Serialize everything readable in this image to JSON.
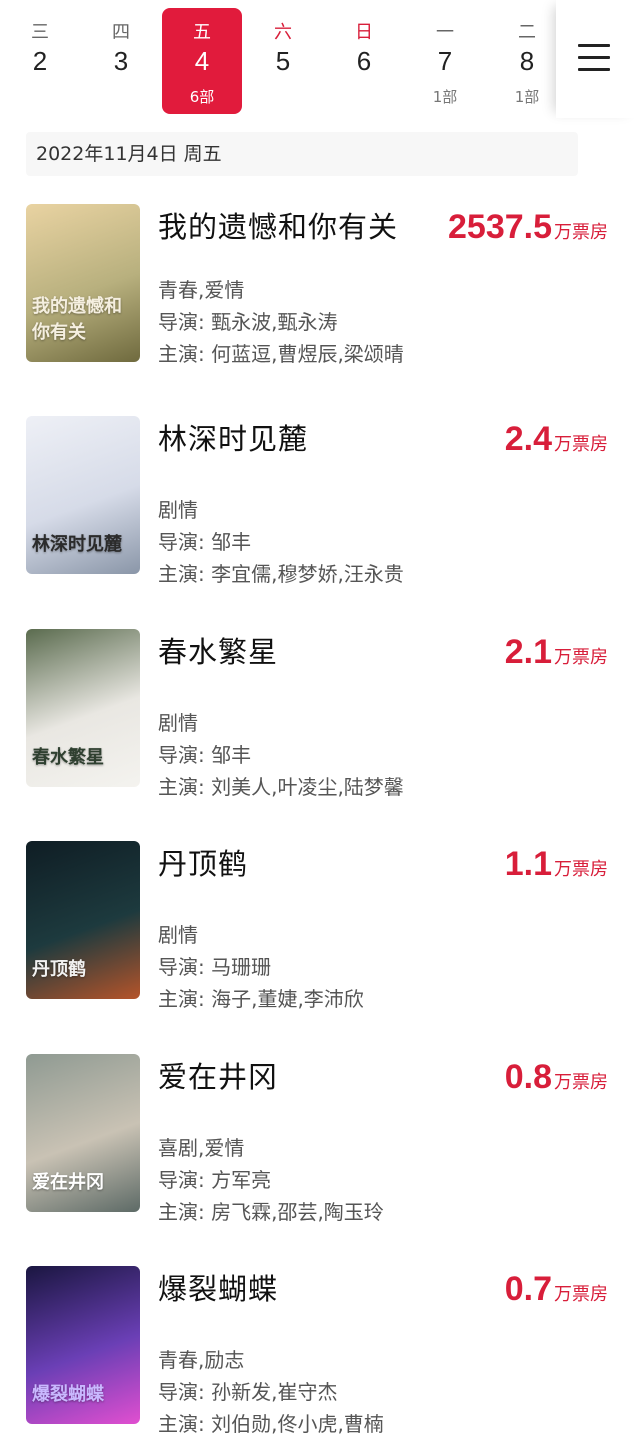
{
  "week": [
    {
      "weekday": "三",
      "date": "2",
      "count": "",
      "weekend": false,
      "active": false
    },
    {
      "weekday": "四",
      "date": "3",
      "count": "",
      "weekend": false,
      "active": false
    },
    {
      "weekday": "五",
      "date": "4",
      "count": "6部",
      "weekend": false,
      "active": true
    },
    {
      "weekday": "六",
      "date": "5",
      "count": "",
      "weekend": true,
      "active": false
    },
    {
      "weekday": "日",
      "date": "6",
      "count": "",
      "weekend": true,
      "active": false
    },
    {
      "weekday": "一",
      "date": "7",
      "count": "1部",
      "weekend": false,
      "active": false
    },
    {
      "weekday": "二",
      "date": "8",
      "count": "1部",
      "weekend": false,
      "active": false
    }
  ],
  "date_header": "2022年11月4日  周五",
  "box_unit": "万票房",
  "director_prefix": "导演: ",
  "cast_prefix": "主演: ",
  "movies": [
    {
      "title": "我的遗憾和你有关",
      "box": "2537.5",
      "genre": "青春,爱情",
      "director": "甄永波,甄永涛",
      "cast": "何蓝逗,曹煜辰,梁颂晴",
      "poster_title": "我的遗憾和你有关",
      "poster_colors": [
        "#e9d3a2",
        "#b8b07e",
        "#6f6a3e"
      ],
      "poster_text_color": "#f5efe0"
    },
    {
      "title": "林深时见麓",
      "box": "2.4",
      "genre": "剧情",
      "director": "邹丰",
      "cast": "李宜儒,穆梦娇,汪永贵",
      "poster_title": "林深时见麓",
      "poster_colors": [
        "#eef0f6",
        "#d6dbe8",
        "#8a96a8"
      ],
      "poster_text_color": "#2b2b2b"
    },
    {
      "title": "春水繁星",
      "box": "2.1",
      "genre": "剧情",
      "director": "邹丰",
      "cast": "刘美人,叶凌尘,陆梦馨",
      "poster_title": "春水繁星",
      "poster_colors": [
        "#5a6b4e",
        "#e9e7e2",
        "#f4f3ef"
      ],
      "poster_text_color": "#2f4030"
    },
    {
      "title": "丹顶鹤",
      "box": "1.1",
      "genre": "剧情",
      "director": "马珊珊",
      "cast": "海子,董婕,李沛欣",
      "poster_title": "丹顶鹤",
      "poster_colors": [
        "#0f1d24",
        "#1d3a3e",
        "#b5542a"
      ],
      "poster_text_color": "#f2f2f2"
    },
    {
      "title": "爱在井冈",
      "box": "0.8",
      "genre": "喜剧,爱情",
      "director": "方军亮",
      "cast": "房飞霖,邵芸,陶玉玲",
      "poster_title": "爱在井冈",
      "poster_colors": [
        "#8f9a92",
        "#c9c2b4",
        "#5d6a66"
      ],
      "poster_text_color": "#ffffff"
    },
    {
      "title": "爆裂蝴蝶",
      "box": "0.7",
      "genre": "青春,励志",
      "director": "孙新发,崔守杰",
      "cast": "刘伯勋,佟小虎,曹楠",
      "poster_title": "爆裂蝴蝶",
      "poster_colors": [
        "#1a1640",
        "#6a3fb5",
        "#e14fd0"
      ],
      "poster_text_color": "#c9b8ff"
    }
  ]
}
